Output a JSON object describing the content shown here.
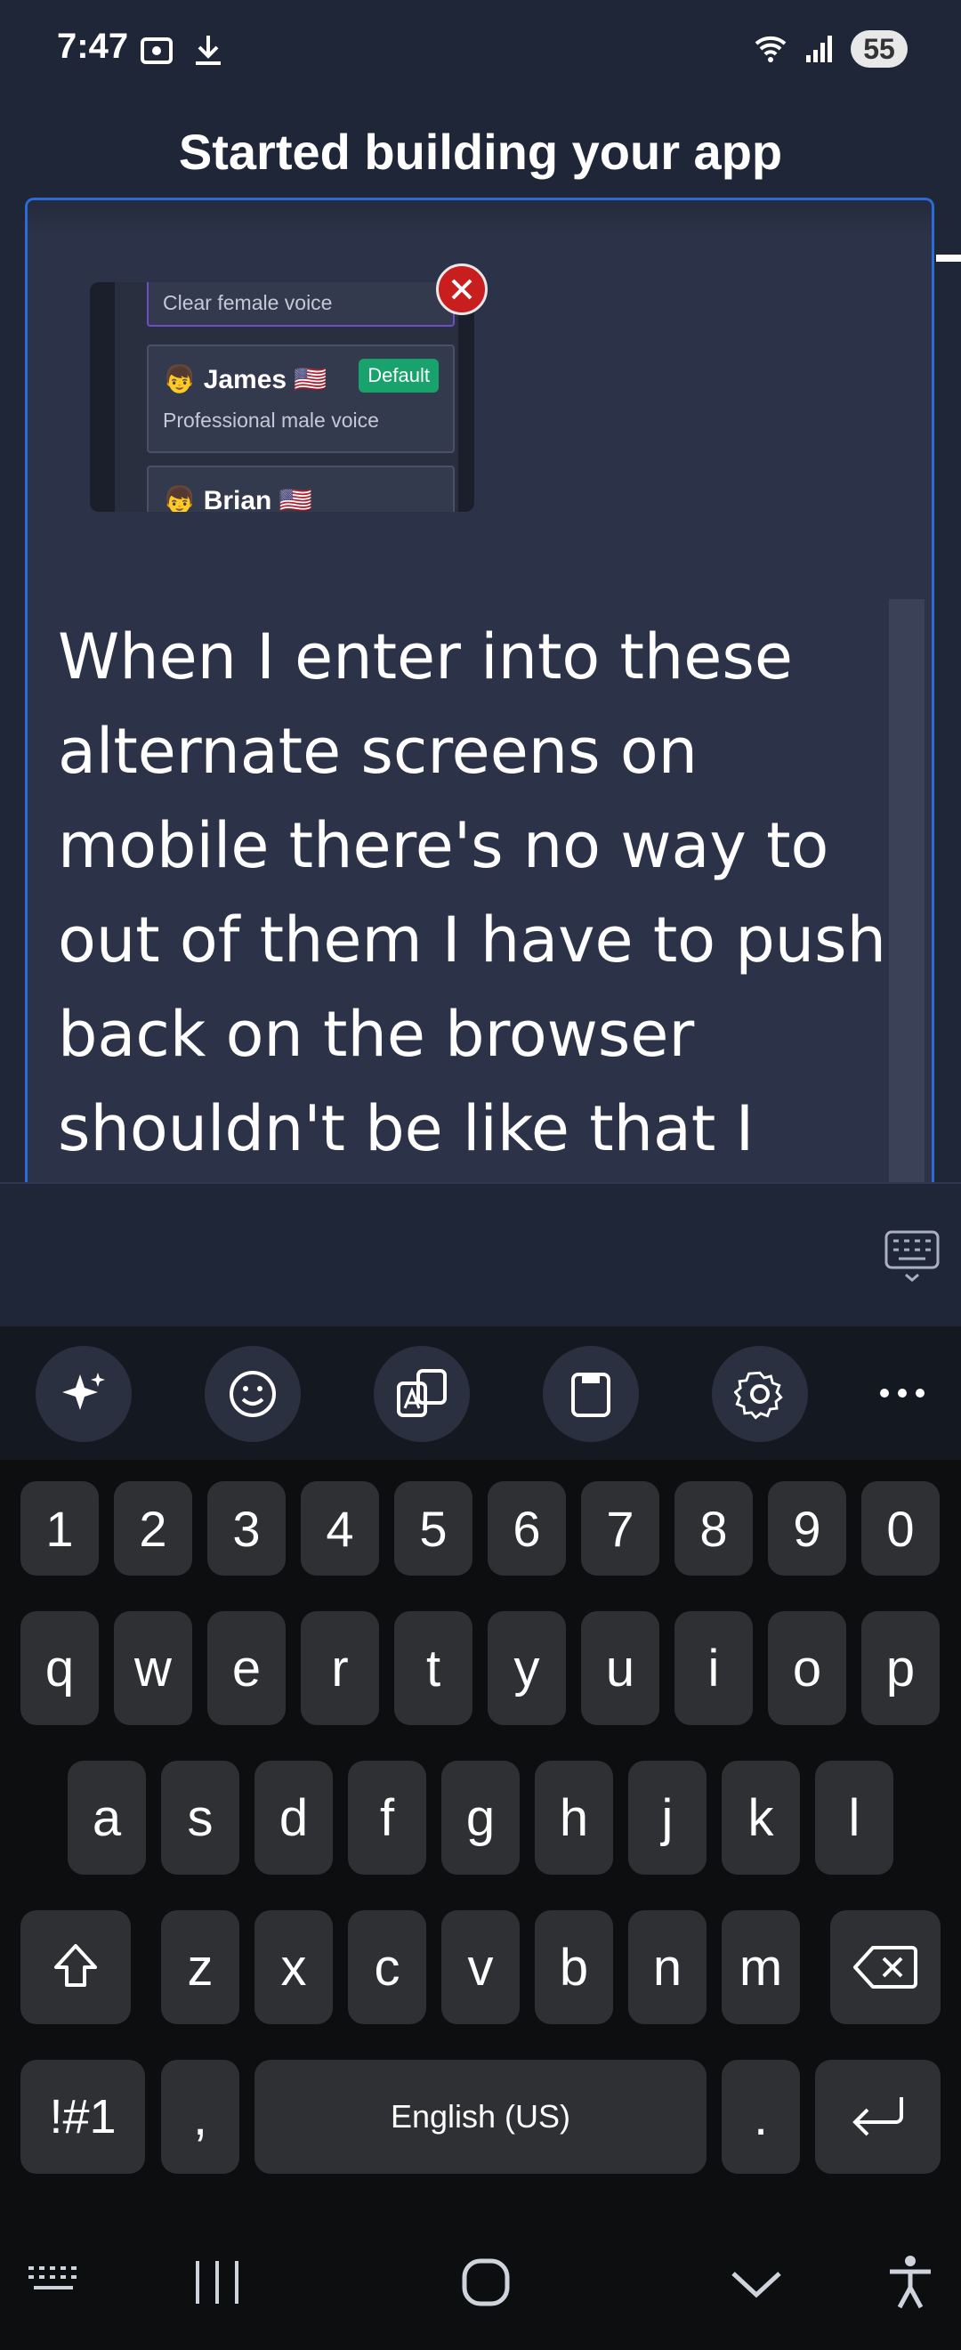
{
  "status": {
    "time": "7:47",
    "battery": "55"
  },
  "title": "Started building your app",
  "attachment": {
    "voices": [
      {
        "name": "",
        "desc": "Clear female voice"
      },
      {
        "name": "👦 James 🇺🇸",
        "desc": "Professional male voice",
        "badge": "Default"
      },
      {
        "name": "👦 Brian 🇺🇸",
        "desc": ""
      }
    ]
  },
  "message_text": "When I enter into these alternate screens on mobile there's no way to out of them I have to push back on the browser shouldn't be like that I also can't see the",
  "keyboard": {
    "numbers": [
      "1",
      "2",
      "3",
      "4",
      "5",
      "6",
      "7",
      "8",
      "9",
      "0"
    ],
    "row1": [
      "q",
      "w",
      "e",
      "r",
      "t",
      "y",
      "u",
      "i",
      "o",
      "p"
    ],
    "row2": [
      "a",
      "s",
      "d",
      "f",
      "g",
      "h",
      "j",
      "k",
      "l"
    ],
    "row3": [
      "z",
      "x",
      "c",
      "v",
      "b",
      "n",
      "m"
    ],
    "symbols_label": "!#1",
    "comma": ",",
    "space_label": "English (US)",
    "period": "."
  },
  "colors": {
    "accent": "#2b6cd6",
    "badge": "#17a36b",
    "close": "#c81e1e"
  }
}
